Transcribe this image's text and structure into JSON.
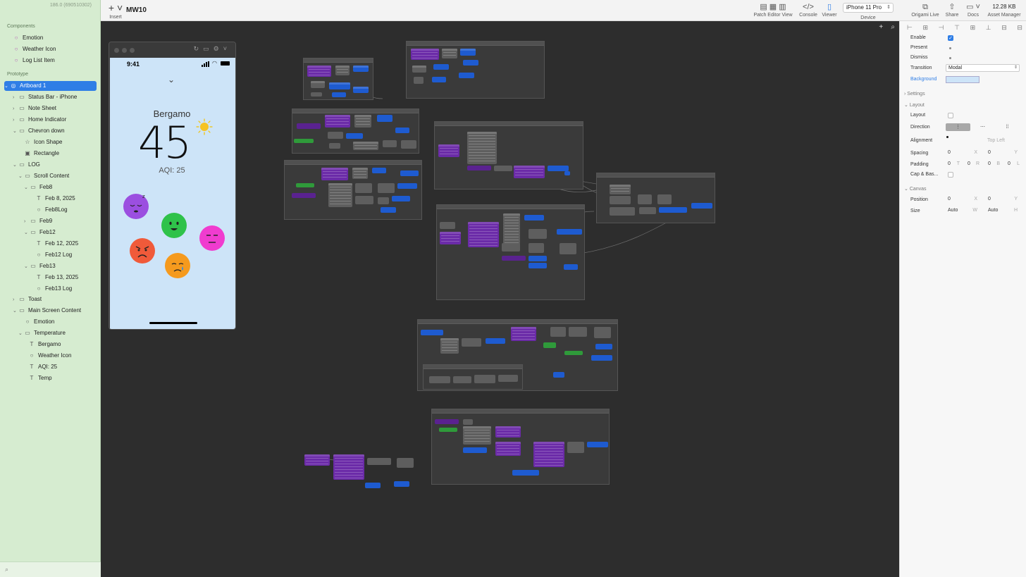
{
  "toolbar": {
    "insert_label": "Insert",
    "doc_title": "MW10",
    "patch_editor_label": "Patch Editor View",
    "console_label": "Console",
    "viewer_label": "Viewer",
    "device_value": "iPhone 11 Pro",
    "device_label": "Device",
    "origami_live_label": "Origami Live",
    "share_label": "Share",
    "docs_label": "Docs",
    "asset_size": "12.28 KB",
    "asset_manager_label": "Asset Manager"
  },
  "sidebar": {
    "version": "186.0 (690510302)",
    "components_header": "Components",
    "components": [
      "Emotion",
      "Weather Icon",
      "Log List Item"
    ],
    "prototype_header": "Prototype",
    "tree": [
      {
        "label": "Artboard 1"
      },
      {
        "label": "Status Bar - iPhone"
      },
      {
        "label": "Note Sheet"
      },
      {
        "label": "Home Indicator"
      },
      {
        "label": "Chevron down"
      },
      {
        "label": "Icon Shape"
      },
      {
        "label": "Rectangle"
      },
      {
        "label": "LOG"
      },
      {
        "label": "Scroll Content"
      },
      {
        "label": "Feb8"
      },
      {
        "label": "Feb 8, 2025"
      },
      {
        "label": "Feb8Log"
      },
      {
        "label": "Feb9"
      },
      {
        "label": "Feb12"
      },
      {
        "label": "Feb 12, 2025"
      },
      {
        "label": "Feb12 Log"
      },
      {
        "label": "Feb13"
      },
      {
        "label": "Feb 13, 2025"
      },
      {
        "label": "Feb13 Log"
      },
      {
        "label": "Toast"
      },
      {
        "label": "Main Screen Content"
      },
      {
        "label": "Emotion"
      },
      {
        "label": "Temperature"
      },
      {
        "label": "Bergamo"
      },
      {
        "label": "Weather Icon"
      },
      {
        "label": "AQI: 25"
      },
      {
        "label": "Temp"
      }
    ]
  },
  "phone": {
    "time": "9:41",
    "city": "Bergamo",
    "temperature": "45",
    "aqi": "AQI: 25",
    "emotion_colors": [
      "#9b4fe0",
      "#2fc24a",
      "#f03ccf",
      "#f05a3a",
      "#f59a1e"
    ],
    "accent_bg": "#cde4f8"
  },
  "inspector": {
    "enable_label": "Enable",
    "present_label": "Present",
    "dismiss_label": "Dismiss",
    "transition_label": "Transition",
    "transition_value": "Modal",
    "background_label": "Background",
    "settings_header": "Settings",
    "layout_header": "Layout",
    "layout_label": "Layout",
    "direction_label": "Direction",
    "alignment_label": "Alignment",
    "alignment_value": "Top Left",
    "spacing_label": "Spacing",
    "spacing_x": "0",
    "spacing_y": "0",
    "padding_label": "Padding",
    "padding_t": "0",
    "padding_r": "0",
    "padding_b": "0",
    "padding_l": "0",
    "cap_label": "Cap & Bas...",
    "canvas_header": "Canvas",
    "position_label": "Position",
    "position_x": "0",
    "position_y": "0",
    "size_label": "Size",
    "size_w": "Auto",
    "size_h": "Auto",
    "unit_x": "X",
    "unit_y": "Y",
    "unit_w": "W",
    "unit_h": "H",
    "unit_t": "T",
    "unit_r": "R",
    "unit_b": "B",
    "unit_l": "L"
  }
}
